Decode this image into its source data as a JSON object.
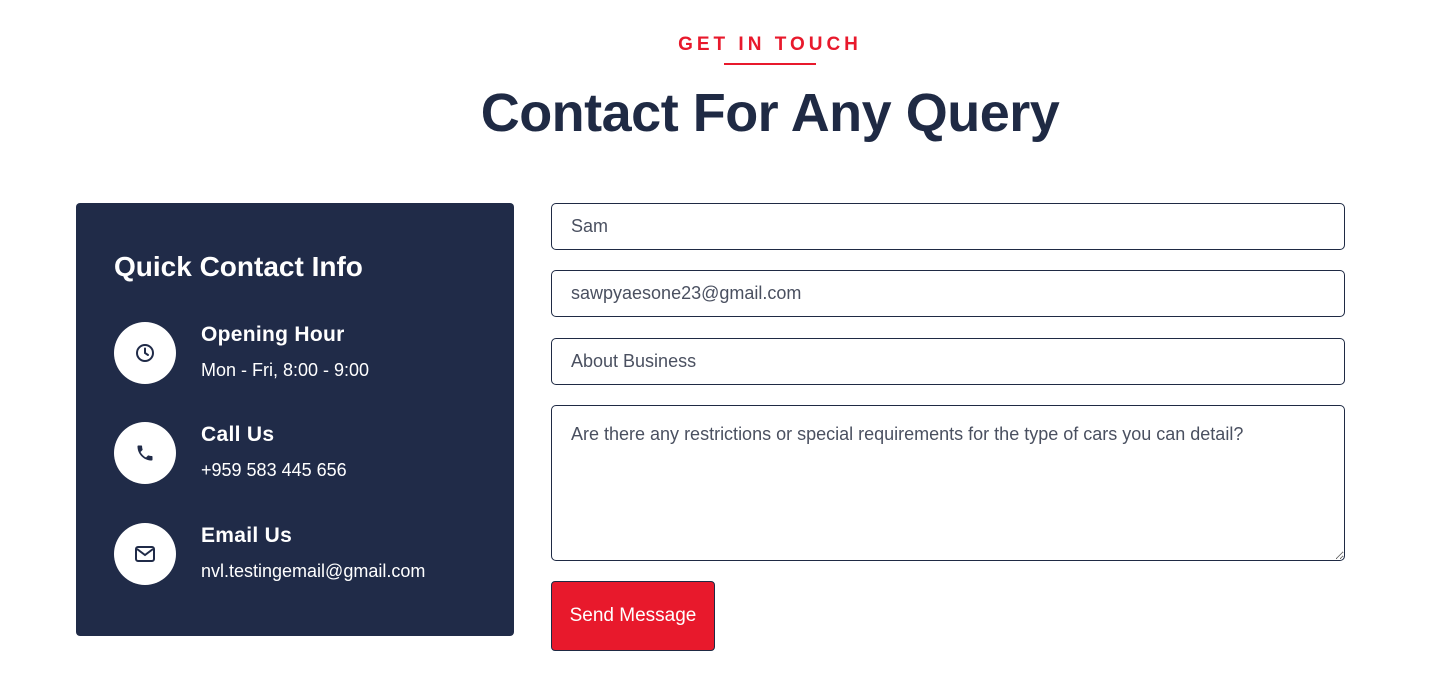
{
  "header": {
    "eyebrow": "GET IN TOUCH",
    "title": "Contact For Any Query"
  },
  "contact_info": {
    "title": "Quick Contact Info",
    "items": [
      {
        "icon": "clock-icon",
        "label": "Opening Hour",
        "value": "Mon - Fri, 8:00 - 9:00"
      },
      {
        "icon": "phone-icon",
        "label": "Call Us",
        "value": "+959 583 445 656"
      },
      {
        "icon": "envelope-icon",
        "label": "Email Us",
        "value": "nvl.testingemail@gmail.com"
      }
    ]
  },
  "form": {
    "name_value": "Sam",
    "email_value": "sawpyaesone23@gmail.com",
    "subject_value": "About Business",
    "message_value": "Are there any restrictions or special requirements for the type of cars you can detail?",
    "submit_label": "Send Message"
  },
  "colors": {
    "accent": "#e8192c",
    "card_background": "#202b48",
    "heading": "#1f2a44"
  }
}
